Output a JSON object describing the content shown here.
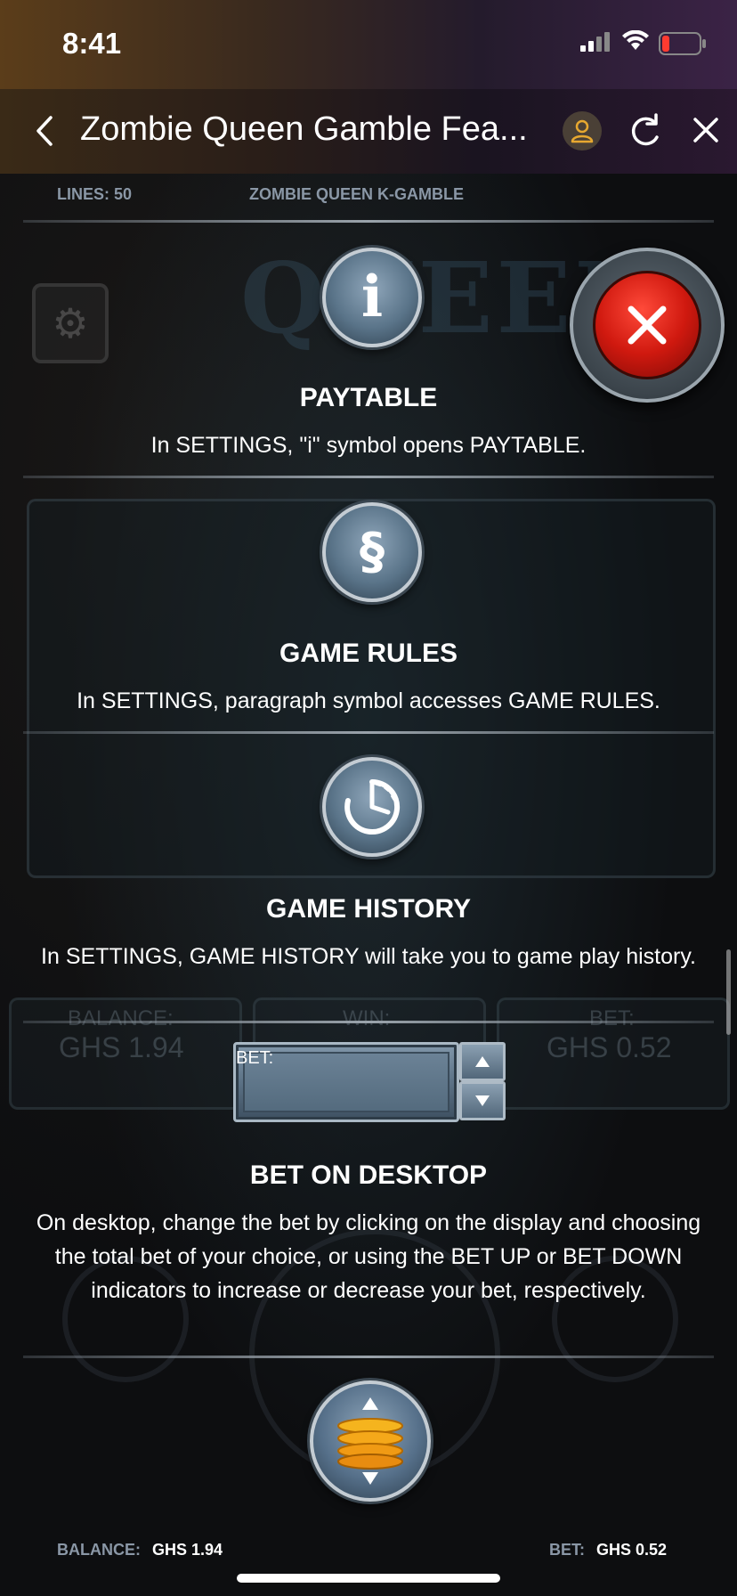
{
  "status_bar": {
    "time": "8:41"
  },
  "header": {
    "title": "Zombie Queen Gamble Fea...",
    "back_icon": "chevron-left-icon",
    "avatar_icon": "user-icon",
    "refresh_icon": "refresh-icon",
    "close_icon": "close-icon"
  },
  "info_strip": {
    "lines": "LINES: 50",
    "game_name": "ZOMBIE QUEEN K-GAMBLE"
  },
  "sections": [
    {
      "icon": "info-icon",
      "icon_text": "i",
      "title": "PAYTABLE",
      "text": "In SETTINGS, \"i\" symbol opens PAYTABLE."
    },
    {
      "icon": "paragraph-icon",
      "icon_text": "§",
      "title": "GAME RULES",
      "text": "In SETTINGS, paragraph symbol accesses GAME RULES."
    },
    {
      "icon": "history-clock-icon",
      "title": "GAME HISTORY",
      "text": "In SETTINGS, GAME HISTORY will take you to game play history."
    },
    {
      "icon": "bet-display-icon",
      "bet_label": "BET:",
      "title": "BET ON DESKTOP",
      "text": "On desktop, change the bet by clicking on the display and choosing the total bet of your choice, or using the BET UP or BET DOWN indicators to increase or decrease your bet, respectively."
    }
  ],
  "background": {
    "balance_label": "BALANCE:",
    "balance_value": "GHS 1.94",
    "win_label": "WIN:",
    "bet_label": "BET:",
    "bet_value": "GHS 0.52",
    "logo_text": "QUEEN"
  },
  "footer": {
    "balance_label": "BALANCE:",
    "balance_value": "GHS 1.94",
    "bet_label": "BET:",
    "bet_value": "GHS 0.52"
  },
  "colors": {
    "accent_red": "#d0190f",
    "label_gray": "#8a97a6",
    "metal_blue": "#5a7489",
    "avatar_gold": "#e7a830"
  }
}
